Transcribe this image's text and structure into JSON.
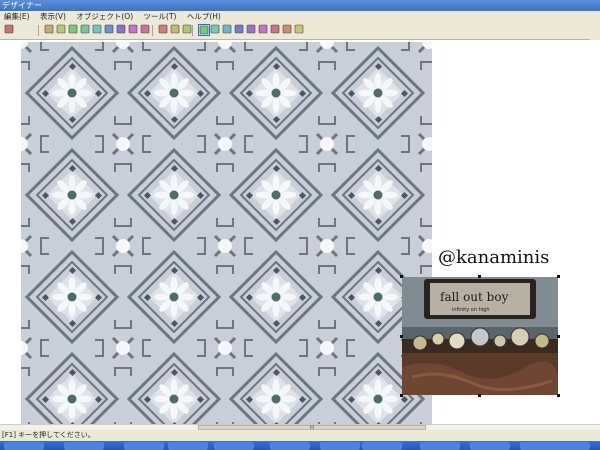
{
  "window": {
    "title": "デザイナー"
  },
  "menu": [
    {
      "label": "編集(E)"
    },
    {
      "label": "表示(V)"
    },
    {
      "label": "オブジェクト(O)"
    },
    {
      "label": "ツール(T)"
    },
    {
      "label": "ヘルプ(H)"
    }
  ],
  "toolbar": {
    "buttons": [
      "eye-icon",
      "new-file-icon",
      "open-folder-icon",
      "save-icon",
      "print-icon",
      "cut-icon",
      "copy-icon",
      "paste-icon",
      "fill-icon",
      "delete-icon",
      "undo-icon",
      "redo-icon",
      "properties-icon",
      "grid-icon",
      "align-icon",
      "layout-icon",
      "frame-icon",
      "image-icon",
      "color-icon",
      "brush-icon",
      "shape-icon",
      "stamp-icon"
    ]
  },
  "canvas": {
    "pattern_colors": {
      "background": "#c9cfd6",
      "line": "#6b7683",
      "tile": "#dfe3e8",
      "flower": "#f6f7f9",
      "center": "#4d6e62",
      "dot": "#4d5763"
    }
  },
  "overlay": {
    "handle": "@kanaminis",
    "photo": {
      "band": "fall out boy",
      "tagline": "infinity on high"
    }
  },
  "scrollbar": {
    "thumb_label": "III"
  },
  "status": {
    "text": "[F1] キーを押してください。"
  }
}
